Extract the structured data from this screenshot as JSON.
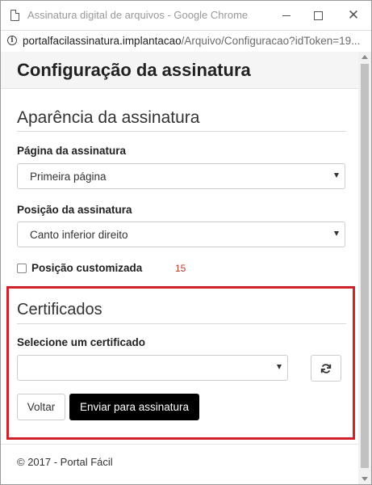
{
  "window": {
    "title": "Assinatura digital de arquivos - Google Chrome",
    "url_host": "portalfacilassinatura.implantacao",
    "url_path": "/Arquivo/Configuracao?idToken=19..."
  },
  "page": {
    "title": "Configuração da assinatura"
  },
  "appearance": {
    "section_title": "Aparência da assinatura",
    "page_label": "Página da assinatura",
    "page_value": "Primeira página",
    "position_label": "Posição da assinatura",
    "position_value": "Canto inferior direito",
    "custom_position_label": "Posição customizada",
    "custom_position_checked": false,
    "annotation_number": "15"
  },
  "certificates": {
    "section_title": "Certificados",
    "select_label": "Selecione um certificado",
    "select_value": "",
    "highlight_color": "#d0202a"
  },
  "actions": {
    "back_label": "Voltar",
    "submit_label": "Enviar para assinatura"
  },
  "footer": {
    "text": "© 2017 - Portal Fácil"
  }
}
